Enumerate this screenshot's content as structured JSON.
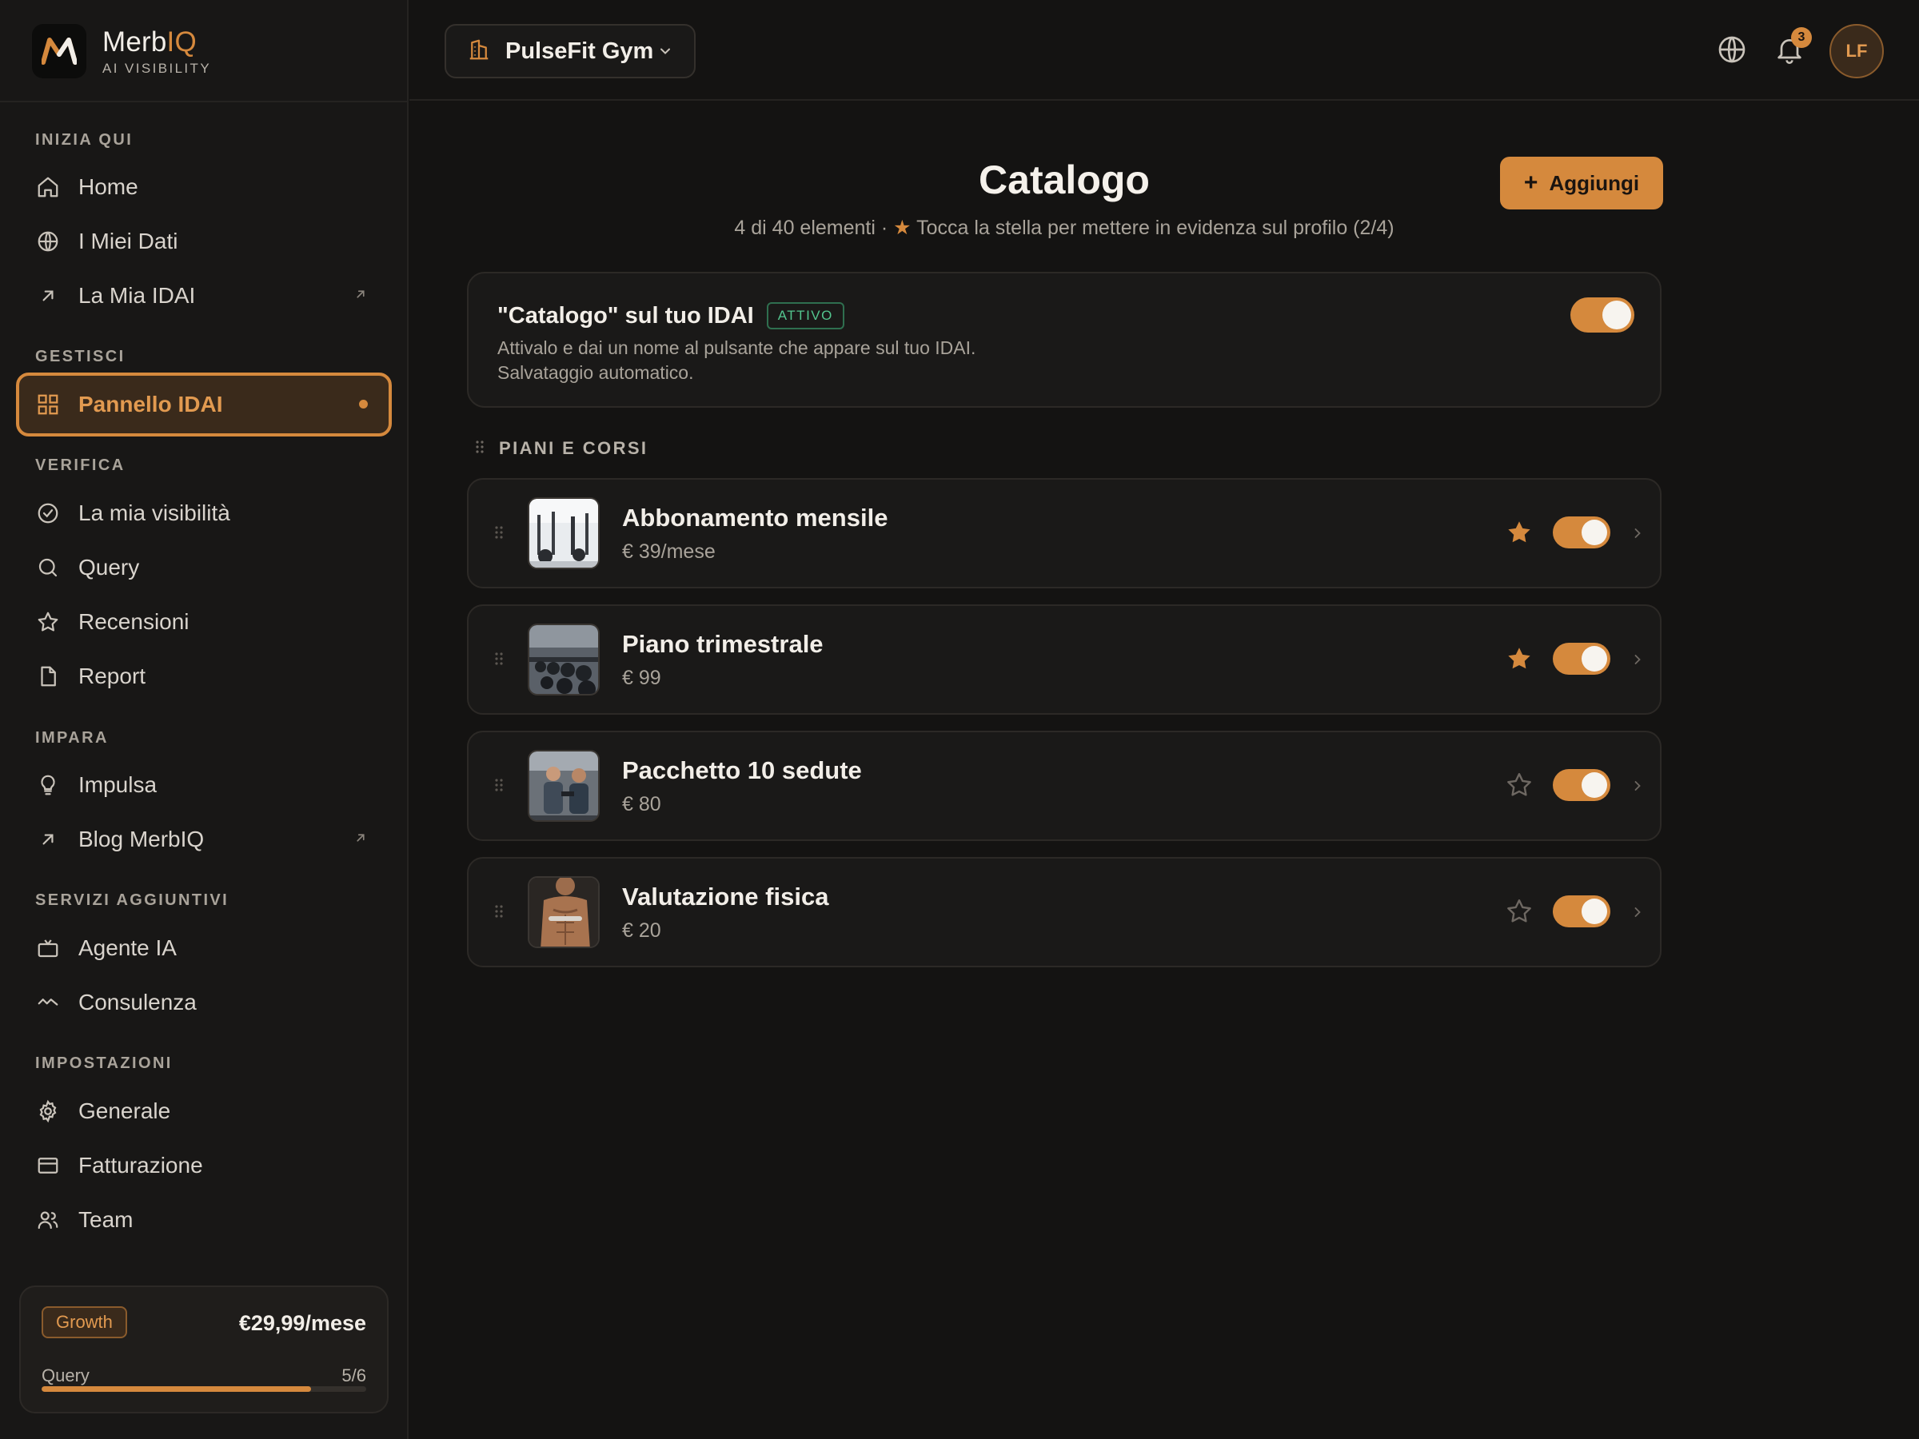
{
  "brand": {
    "name_main": "Merb",
    "name_accent": "IQ",
    "tagline": "AI VISIBILITY"
  },
  "sidebar": {
    "sections": {
      "start": "INIZIA QUI",
      "manage": "GESTISCI",
      "verify": "VERIFICA",
      "learn": "IMPARA",
      "services": "SERVIZI AGGIUNTIVI",
      "settings": "IMPOSTAZIONI"
    },
    "items": {
      "home": "Home",
      "my_data": "I Miei Dati",
      "my_idai": "La Mia IDAI",
      "panel": "Pannello IDAI",
      "visibility": "La mia visibilità",
      "query": "Query",
      "reviews": "Recensioni",
      "report": "Report",
      "impulsa": "Impulsa",
      "blog": "Blog MerbIQ",
      "agent": "Agente IA",
      "consulting": "Consulenza",
      "general": "Generale",
      "billing": "Fatturazione",
      "team": "Team"
    },
    "active_item": "panel"
  },
  "plan": {
    "name": "Growth",
    "price": "€29,99/mese",
    "usage_label": "Query",
    "usage_text": "5/6",
    "usage_fraction": 0.83
  },
  "topbar": {
    "business_name": "PulseFit Gym",
    "notification_count": "3",
    "avatar_initials": "LF"
  },
  "main": {
    "title": "Catalogo",
    "subtitle_count": "4 di 40 elementi ·",
    "subtitle_hint": "Tocca la stella per mettere in evidenza sul profilo (2/4)",
    "add_button": "Aggiungi",
    "feature": {
      "title": "\"Catalogo\" sul tuo IDAI",
      "status": "ATTIVO",
      "desc_line1": "Attivalo e dai un nome al pulsante che appare sul tuo IDAI.",
      "desc_line2": "Salvataggio automatico.",
      "enabled": true
    },
    "group_label": "PIANI E CORSI",
    "items": [
      {
        "name": "Abbonamento mensile",
        "price": "€ 39/mese",
        "featured": true,
        "enabled": true,
        "thumb": "gym-machines"
      },
      {
        "name": "Piano trimestrale",
        "price": "€ 99",
        "featured": true,
        "enabled": true,
        "thumb": "dumbbell-rack"
      },
      {
        "name": "Pacchetto 10 sedute",
        "price": "€ 80",
        "featured": false,
        "enabled": true,
        "thumb": "personal-training"
      },
      {
        "name": "Valutazione fisica",
        "price": "€ 20",
        "featured": false,
        "enabled": true,
        "thumb": "body-assessment"
      }
    ]
  },
  "colors": {
    "accent": "#d5893d",
    "background": "#141312",
    "sidebar": "#181716",
    "card": "#1a1918",
    "success": "#53c58e"
  }
}
